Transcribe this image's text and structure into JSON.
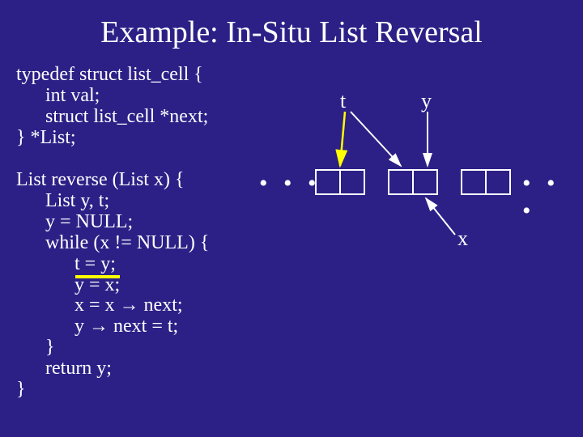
{
  "title": "Example: In-Situ List Reversal",
  "struct": {
    "l1": "typedef struct list_cell {",
    "l2": "int val;",
    "l3": "struct list_cell *next;",
    "l4": "} *List;"
  },
  "func": {
    "l1": "List reverse (List x) {",
    "l2": "List y, t;",
    "l3": "y = NULL;",
    "l4": "while (x != NULL) {",
    "l5": "t = y;",
    "l6": "y = x;",
    "l7": "x = x → next;",
    "l8": "y → next = t;",
    "l9": "}",
    "l10": "return y;",
    "l11": "}"
  },
  "labels": {
    "t": "t",
    "y": "y",
    "x": "x",
    "dots": "• • •"
  }
}
